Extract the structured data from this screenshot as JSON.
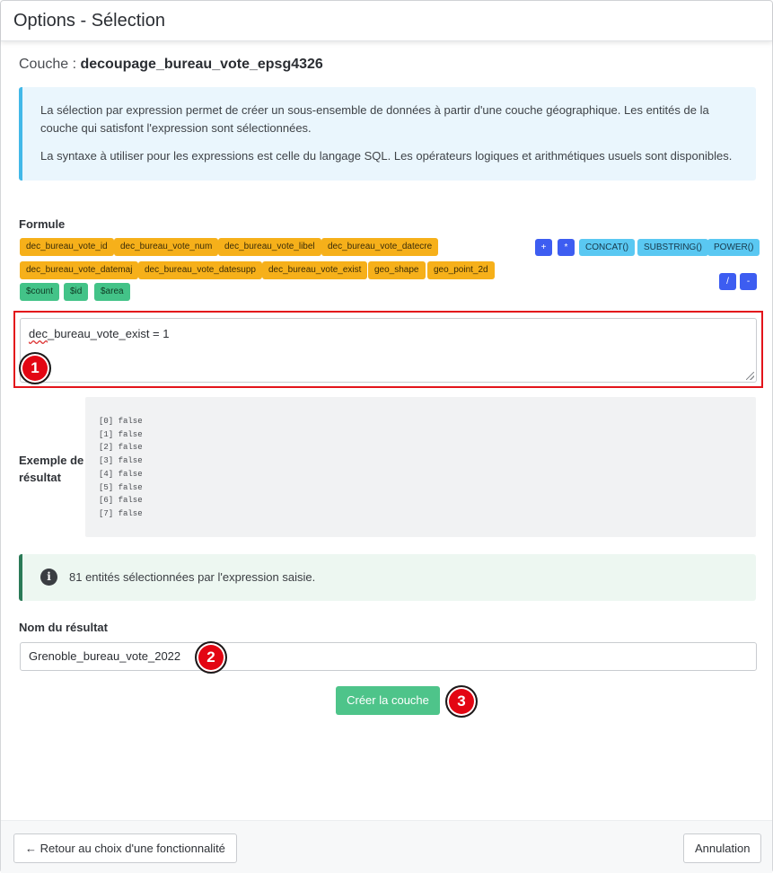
{
  "header": {
    "title": "Options - Sélection"
  },
  "couche": {
    "label": "Couche : ",
    "name": "decoupage_bureau_vote_epsg4326"
  },
  "info": {
    "p1": "La sélection par expression permet de créer un sous-ensemble de données à partir d'une couche géographique. Les entités de la couche qui satisfont l'expression sont sélectionnées.",
    "p2": "La syntaxe à utiliser pour les expressions est celle du langage SQL. Les opérateurs logiques et arithmétiques usuels sont disponibles."
  },
  "formula": {
    "label": "Formule",
    "fields": [
      "dec_bureau_vote_id",
      "dec_bureau_vote_num",
      "dec_bureau_vote_libel",
      "dec_bureau_vote_datecre",
      "dec_bureau_vote_datemaj",
      "dec_bureau_vote_datesupp",
      "dec_bureau_vote_exist",
      "geo_shape",
      "geo_point_2d"
    ],
    "variables": [
      "$count",
      "$id",
      "$area"
    ],
    "operators": [
      "+",
      "*",
      "/",
      "-"
    ],
    "functions": [
      "CONCAT()",
      "SUBSTRING()",
      "POWER()"
    ],
    "expression_part1": "dec",
    "expression_part2": "_bureau_vote_exist = 1"
  },
  "badges": [
    "1",
    "2",
    "3"
  ],
  "example": {
    "label_line1": "Exemple de",
    "label_line2": "résultat",
    "lines": [
      "[0] false",
      "[1] false",
      "[2] false",
      "[3] false",
      "[4] false",
      "[5] false",
      "[6] false",
      "[7] false"
    ]
  },
  "result_message": "81 entités sélectionnées par l'expression saisie.",
  "result_name": {
    "label": "Nom du résultat",
    "value": "Grenoble_bureau_vote_2022"
  },
  "buttons": {
    "create": "Créer la couche",
    "back": "Retour au choix d'une fonctionnalité",
    "cancel": "Annulation"
  },
  "colors": {
    "field_chip": "#f6b01a",
    "variable_chip": "#43c388",
    "operator_chip": "#3d5df1",
    "function_chip": "#5ac8f2",
    "highlight_frame": "#e3141b",
    "create_button": "#4ec48a"
  }
}
